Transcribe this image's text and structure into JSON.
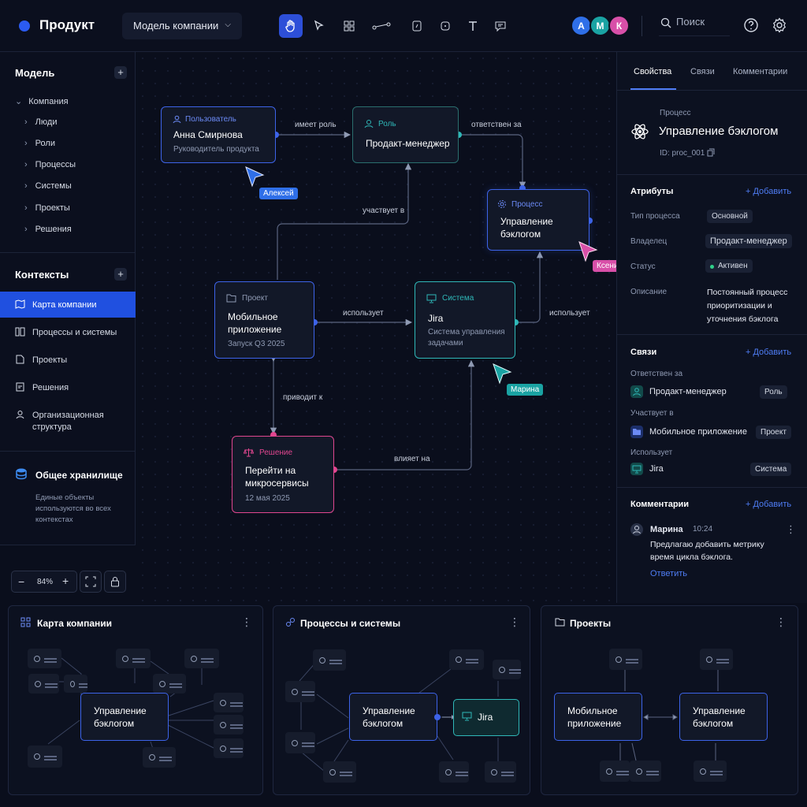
{
  "app": {
    "title": "Продукт",
    "model_select": "Модель компании",
    "search_placeholder": "Поиск"
  },
  "users": [
    {
      "initial": "А",
      "color": "#2f6fe8"
    },
    {
      "initial": "М",
      "color": "#1aa3a3"
    },
    {
      "initial": "К",
      "color": "#d84fa8"
    }
  ],
  "sidebar": {
    "model_title": "Модель",
    "tree": {
      "root": "Компания",
      "items": [
        "Люди",
        "Роли",
        "Процессы",
        "Системы",
        "Проекты",
        "Решения"
      ]
    },
    "contexts_title": "Контексты",
    "contexts": [
      "Карта компании",
      "Процессы и системы",
      "Проекты",
      "Решения",
      "Организационная структура"
    ],
    "storage": {
      "title": "Общее хранилище",
      "desc": "Единые объекты используются во всех контекстах"
    }
  },
  "canvas": {
    "nodes": {
      "user": {
        "type": "Пользователь",
        "title": "Анна Смирнова",
        "subtitle": "Руководитель продукта"
      },
      "role": {
        "type": "Роль",
        "title": "Продакт-менеджер"
      },
      "process": {
        "type": "Процесс",
        "title": "Управление бэклогом"
      },
      "project": {
        "type": "Проект",
        "title": "Мобильное приложение",
        "subtitle": "Запуск Q3 2025"
      },
      "system": {
        "type": "Система",
        "title": "Jira",
        "subtitle": "Система управления задачами"
      },
      "decision": {
        "type": "Решение",
        "title": "Перейти на микросервисы",
        "subtitle": "12 мая 2025"
      }
    },
    "edges": {
      "has_role": "имеет роль",
      "responsible": "ответствен за",
      "participates": "участвует в",
      "uses1": "использует",
      "uses2": "использует",
      "leads_to": "приводит к",
      "affects": "влияет на"
    },
    "cursors": {
      "a": "Алексей",
      "b": "Ксения",
      "c": "Марина"
    },
    "cursor_colors": {
      "a": "#2f6fe8",
      "b": "#d84fa8",
      "c": "#1aa3a3"
    }
  },
  "zoom": {
    "level": "84%"
  },
  "panel": {
    "tabs": [
      "Свойства",
      "Связи",
      "Комментарии"
    ],
    "object": {
      "kind": "Процесс",
      "name": "Управление бэклогом",
      "id": "ID: proc_001"
    },
    "attributes_title": "Атрибуты",
    "add": "+ Добавить",
    "attributes": {
      "type_label": "Тип процесса",
      "type_value": "Основной",
      "owner_label": "Владелец",
      "owner_value": "Продакт-менеджер",
      "status_label": "Статус",
      "status_value": "Активен",
      "desc_label": "Описание",
      "desc_value": "Постоянный процесс приоритизации и уточнения бэклога"
    },
    "links_title": "Связи",
    "links": [
      {
        "group": "Ответствен за",
        "name": "Продакт-менеджер",
        "tag": "Роль"
      },
      {
        "group": "Участвует в",
        "name": "Мобильное приложение",
        "tag": "Проект"
      },
      {
        "group": "Использует",
        "name": "Jira",
        "tag": "Система"
      }
    ],
    "comments_title": "Комментарии",
    "comment": {
      "author": "Марина",
      "time": "10:24",
      "text": "Предлагаю добавить метрику время цикла бэклога.",
      "reply": "Ответить"
    }
  },
  "cards": [
    {
      "title": "Карта компании",
      "center": "Управление бэклогом"
    },
    {
      "title": "Процессы и системы",
      "center": "Управление бэклогом",
      "side": "Jira"
    },
    {
      "title": "Проекты",
      "left": "Мобильное приложение",
      "right": "Управление бэклогом"
    }
  ],
  "colors": {
    "accent": "#2050e0",
    "teal": "#2fb8b8",
    "pink": "#e0468f",
    "user_border": "#3d63e8"
  }
}
